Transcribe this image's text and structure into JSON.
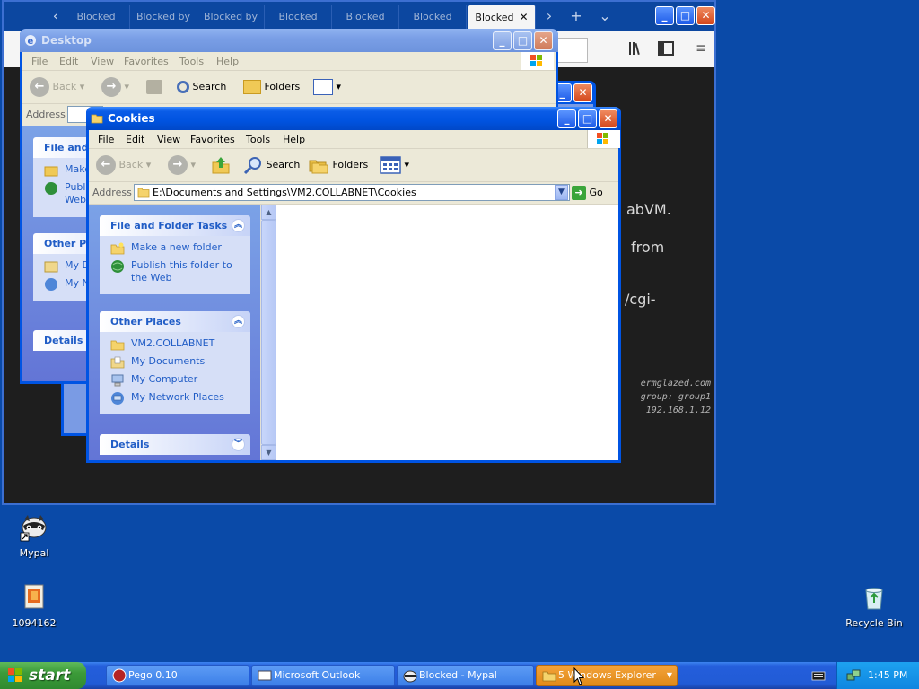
{
  "browser": {
    "tabs": [
      "Blocked",
      "Blocked by",
      "Blocked by",
      "Blocked",
      "Blocked",
      "Blocked",
      "Blocked"
    ],
    "active_tab_close": "✕",
    "new_tab": "+",
    "tab_list": "⌄",
    "body_fragments": [
      "abVM.",
      "from",
      "/cgi-"
    ],
    "info_lines": [
      "ermglazed.com",
      "group: group1",
      "192.168.1.12"
    ]
  },
  "desktop_window": {
    "title": "Desktop",
    "menu": [
      "File",
      "Edit",
      "View",
      "Favorites",
      "Tools",
      "Help"
    ],
    "toolbar": {
      "back": "Back",
      "search": "Search",
      "folders": "Folders"
    },
    "address_label": "Address",
    "panel_headers": [
      "File and",
      "Other Pl",
      "Details"
    ],
    "panel_links": [
      "Make",
      "Publi",
      "Web",
      "My D",
      "My N"
    ]
  },
  "cookies_window": {
    "title": "Cookies",
    "menu": [
      "File",
      "Edit",
      "View",
      "Favorites",
      "Tools",
      "Help"
    ],
    "toolbar": {
      "back": "Back",
      "search": "Search",
      "folders": "Folders"
    },
    "address_label": "Address",
    "address_value": "E:\\Documents and Settings\\VM2.COLLABNET\\Cookies",
    "go_label": "Go",
    "file_tasks": {
      "header": "File and Folder Tasks",
      "links": [
        "Make a new folder",
        "Publish this folder to",
        "the Web"
      ]
    },
    "other_places": {
      "header": "Other Places",
      "links": [
        "VM2.COLLABNET",
        "My Documents",
        "My Computer",
        "My Network Places"
      ]
    },
    "details": {
      "header": "Details"
    }
  },
  "desktop_icons": [
    "Mypal",
    "1094162",
    "Recycle Bin"
  ],
  "taskbar": {
    "start_label": "start",
    "tasks": [
      "Pego 0.10",
      "Microsoft Outlook",
      "Blocked - Mypal",
      "5 Windows Explorer"
    ],
    "clock": "1:45 PM"
  },
  "colors": {
    "desktop": "#0a4aa8",
    "xp_titlebar": "#0053e0",
    "task_pane": "#6d8ddf",
    "taskbar": "#245edb",
    "start_button": "#3c9b39",
    "active_task": "#e08a18"
  }
}
